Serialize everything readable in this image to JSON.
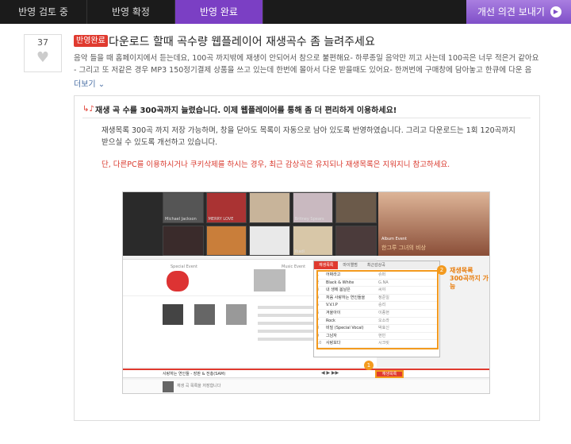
{
  "nav": {
    "tabs": [
      {
        "label": "반영 검토 중"
      },
      {
        "label": "반영 확정"
      },
      {
        "label": "반영 완료"
      }
    ],
    "active_tab_index": 2,
    "feedback_label": "개선 의견 보내기",
    "accent_color": "#7b3fc4"
  },
  "post": {
    "like_count": "37",
    "status": "반영완료",
    "title": "다운로드 할때 곡수량 웹플레이어 재생곡수 좀 늘려주세요",
    "body_line1": "음악 들을 때 홈페이지에서 듣는데요, 100곡 까지밖에 재생이 안되어서 참으로 불편해요- 하루종일 음악만 끼고 사는데 100곡은 너무 적은거 같아요",
    "body_line2": "- 그리고 또 저같은 경우 MP3 150정기결제 상품을 쓰고 있는데 한번에 몰아서 다운 받을때도 있어요- 한꺼번에 구매창에 담아놓고 한큐에 다운 음",
    "more_label": "더보기"
  },
  "reply": {
    "title": "재생 곡 수를 300곡까지 늘렸습니다. 이제 웹플레이어를 통해 좀 더 편리하게 이용하세요!",
    "text": "재생목록 300곡 까지 저장 가능하며, 창을 닫아도 목록이 자동으로 남아 있도록 반영하였습니다. 그리고 다운로드는 1회 120곡까지 받으실 수 있도록 개선하고 있습니다.",
    "warning": "단, 다른PC를 이용하시거나 쿠키삭제를 하시는 경우, 최근 감상곡은 유지되나 재생목록은 지워지니 참고하세요."
  },
  "screenshot": {
    "albums": [
      "Michael Jackson",
      "MERRY LOVE",
      "",
      "Britney Spears",
      "",
      "",
      "",
      "",
      "Ibadi",
      ""
    ],
    "album_event": {
      "label": "Album Event",
      "title": "한그루 그녀의 비상"
    },
    "events": [
      "Special Event",
      "Music Event"
    ],
    "playlist_tabs": [
      "재생목록",
      "마이앨범",
      "최근감상곡"
    ],
    "playlist_rows": [
      {
        "no": "1",
        "title": "어쩌라고",
        "artist": "슈퍼"
      },
      {
        "no": "2",
        "title": "Black & White",
        "artist": "G.NA"
      },
      {
        "no": "3",
        "title": "내 생에 봄날은",
        "artist": "씨야"
      },
      {
        "no": "4",
        "title": "처음 사랑하는 연인들을",
        "artist": "정준일"
      },
      {
        "no": "5",
        "title": "V.V.I.P",
        "artist": "승리"
      },
      {
        "no": "6",
        "title": "겨울아이",
        "artist": "이종현"
      },
      {
        "no": "7",
        "title": "Rock",
        "artist": "오소라"
      },
      {
        "no": "8",
        "title": "비밀 (Special Vocal)",
        "artist": "박효신"
      },
      {
        "no": "9",
        "title": "그남자",
        "artist": "현빈"
      },
      {
        "no": "10",
        "title": "사랑보다",
        "artist": "시크릿"
      }
    ],
    "callout_line1": "재생목록",
    "callout_line2": "300곡까지 가능",
    "badge1": "1",
    "badge2": "2",
    "now_playing": "사랑하는 연인들 - 장판 & 전총(SAM)",
    "list_count": "재생목록",
    "bottom_text": "재생 곡 목록을 저장합니다"
  }
}
